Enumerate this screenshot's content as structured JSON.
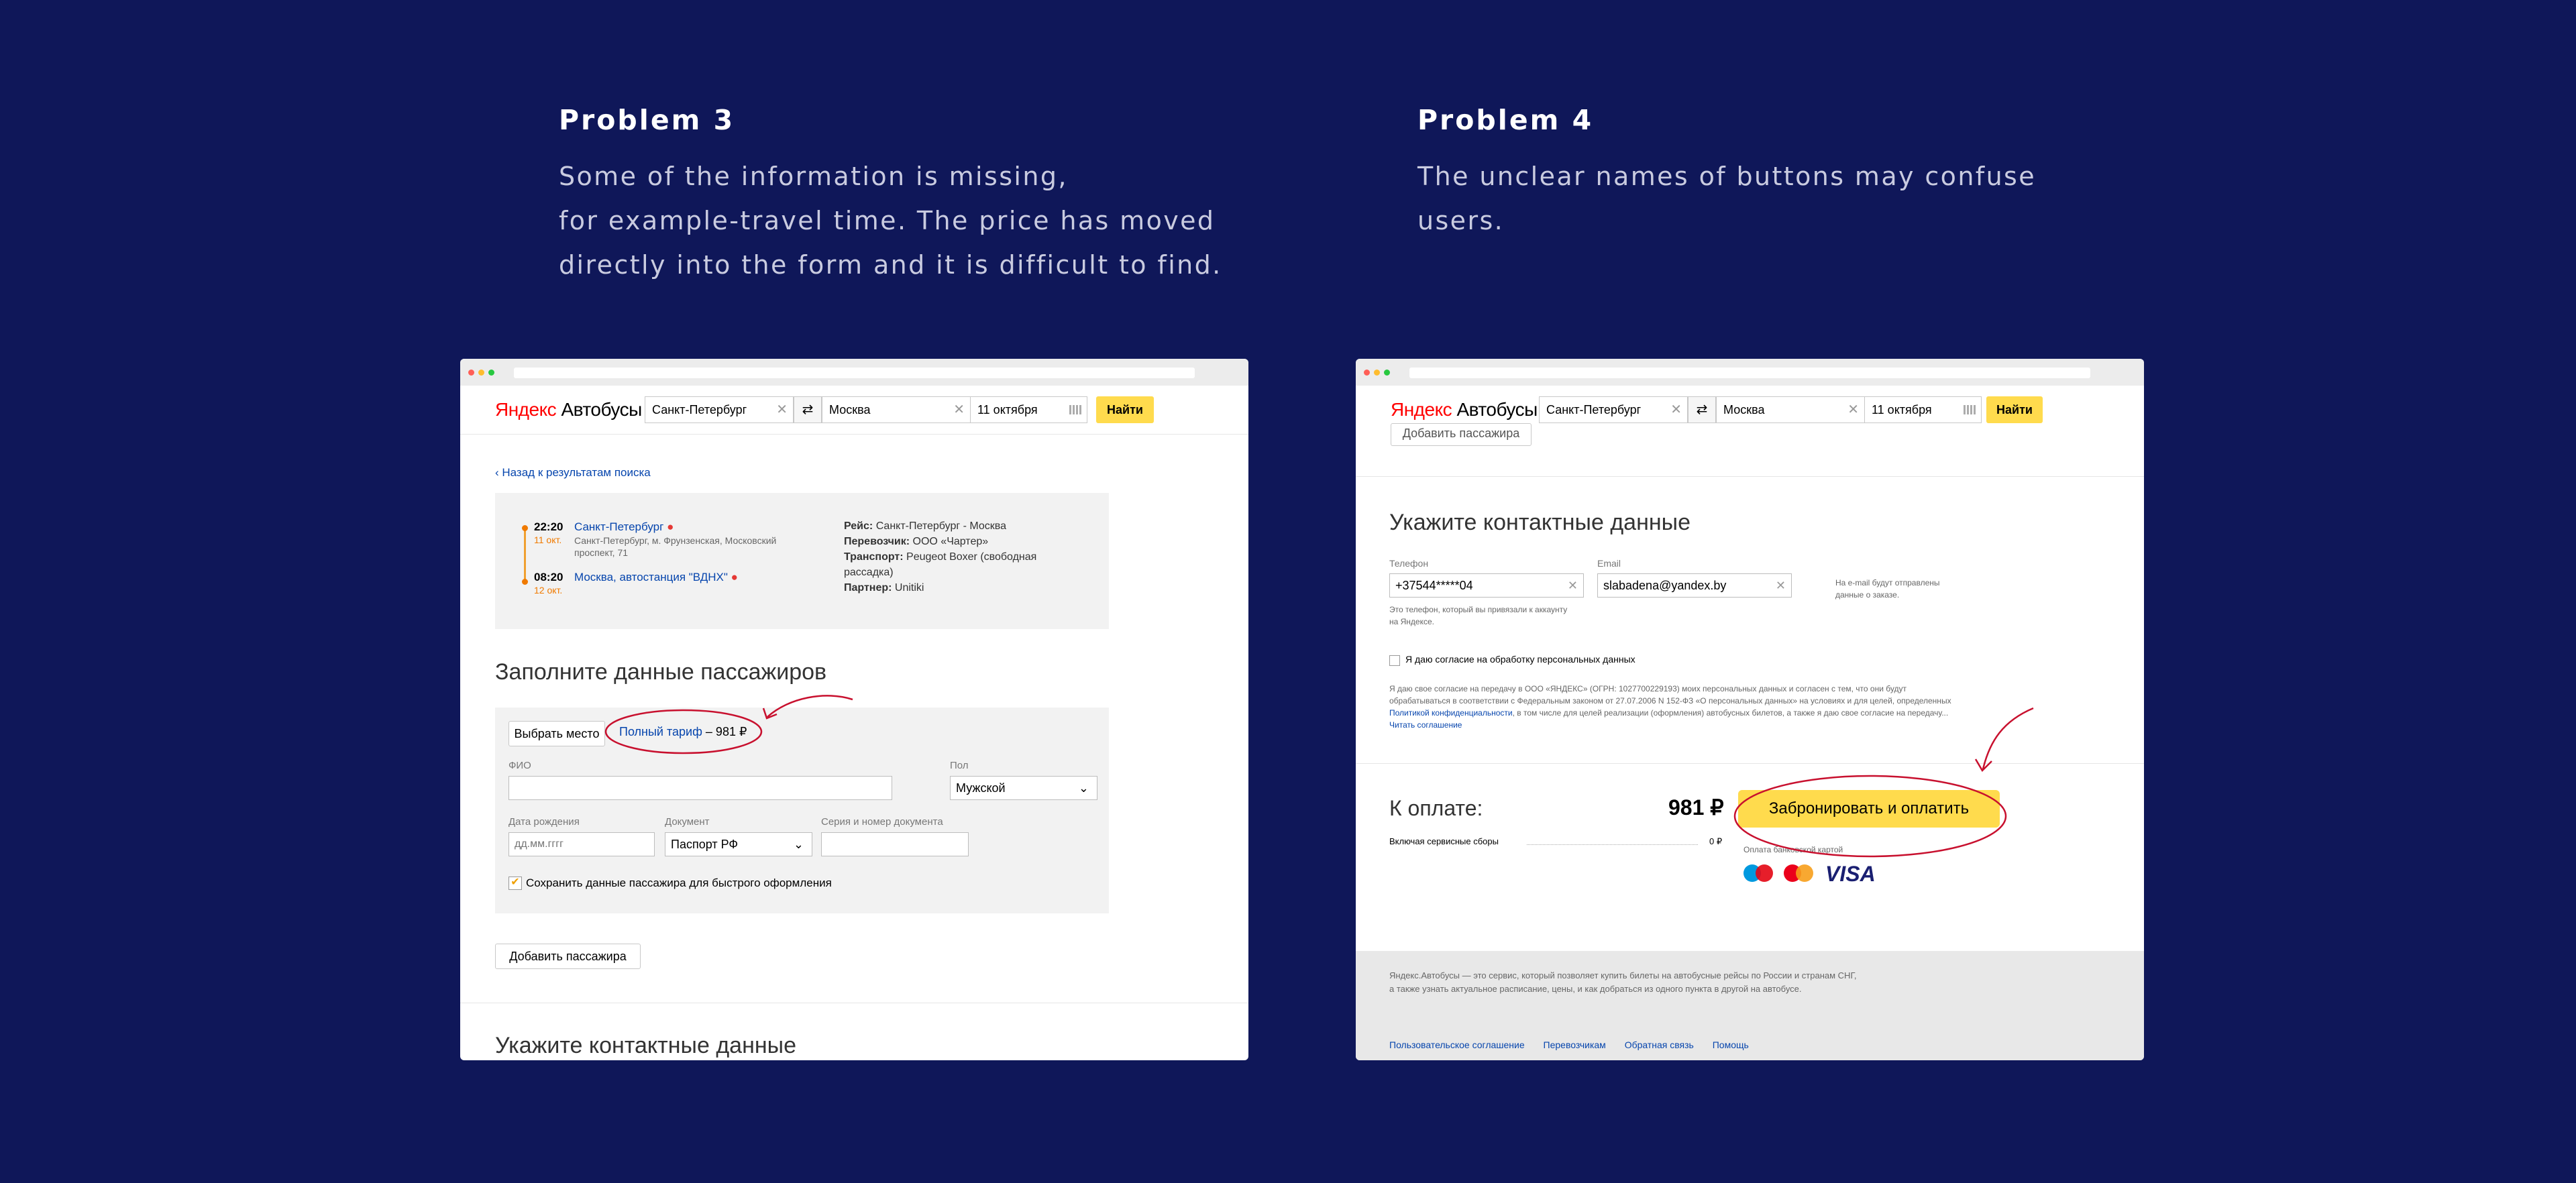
{
  "left": {
    "heading": "Problem 3",
    "description": [
      "Some of the information is missing,",
      "for example-travel time. The price has moved",
      "directly into the form and it is difficult to find."
    ],
    "screenshot": {
      "logo": "Яндекс",
      "logo_product": "Автобусы",
      "from": "Санкт-Петербург",
      "to": "Москва",
      "date": "11 октября",
      "find": "Найти",
      "back_link": "Назад к результатам поиска",
      "depart_time": "22:20",
      "depart_date": "11 окт.",
      "depart_city": "Санкт-Петербург",
      "depart_address": [
        "Санкт-Петербург, м. Фрунзенская, Московский",
        "проспект, 71"
      ],
      "arrive_time": "08:20",
      "arrive_date": "12 окт.",
      "arrive_place": "Москва, автостанция \"ВДНХ\"",
      "route_label": "Рейс:",
      "route_value": "Санкт-Петербург - Москва",
      "carrier_label": "Перевозчик:",
      "carrier_value": "ООО «Чартер»",
      "transport_label": "Транспорт:",
      "transport_value": [
        "Peugeot Boxer (свободная",
        "рассадка)"
      ],
      "partner_label": "Партнер:",
      "partner_value": "Unitiki",
      "passengers_title": "Заполните данные пассажиров",
      "choose_seat": "Выбрать место",
      "tariff_link": "Полный тариф",
      "tariff_price": " – 981 ₽",
      "name_label": "ФИО",
      "gender_label": "Пол",
      "gender_value": "Мужской",
      "birth_label": "Дата рождения",
      "birth_placeholder": "дд.мм.гггг",
      "doc_label": "Документ",
      "doc_value": "Паспорт РФ",
      "doc_number_label": "Серия и номер документа",
      "save_data": "Сохранить данные пассажира для быстрого оформления",
      "add_passenger": "Добавить пассажира",
      "contacts_title": "Укажите контактные данные"
    }
  },
  "right": {
    "heading": "Problem 4",
    "description": [
      "The unclear names of buttons may confuse",
      "users."
    ],
    "screenshot": {
      "logo": "Яндекс",
      "logo_product": "Автобусы",
      "from": "Санкт-Петербург",
      "to": "Москва",
      "date": "11 октября",
      "find": "Найти",
      "top_clipped": "Добавить пассажира",
      "contacts_title": "Укажите контактные данные",
      "phone_label": "Телефон",
      "phone_value": "+37544*****04",
      "phone_hint": [
        "Это телефон, который вы привязали к аккаунту",
        "на Яндексе."
      ],
      "email_label": "Email",
      "email_value": "slabadena@yandex.by",
      "email_hint": [
        "На e-mail будут отправлены",
        "данные о заказе."
      ],
      "consent_label": "Я даю согласие на обработку персональных данных",
      "consent_text": [
        "Я даю свое согласие на передачу в ООО «ЯНДЕКС» (ОГРН: 1027700229193) моих персональных данных и согласен с тем, что они будут",
        "обрабатываться в соответствии с Федеральным законом от 27.07.2006 N 152-ФЗ «О персональных данных» на условиях и для целей, определенных",
        ", в том числе для целей реализации (оформления) автобусных билетов, а также я даю свое согласие на передачу..."
      ],
      "privacy_link": "Политикой конфиденциальности",
      "read_agreement": "Читать соглашение",
      "pay_label": "К оплате:",
      "pay_amount": "981 ₽",
      "service_fee_label": "Включая сервисные сборы",
      "service_fee_value": "0 ₽",
      "pay_button": "Забронировать и оплатить",
      "card_payment": "Оплата банковской картой",
      "visa": "VISA",
      "footer_text": [
        "Яндекс.Автобусы — это сервис, который позволяет купить билеты на автобусные рейсы по России и странам СНГ,",
        "а также узнать актуальное расписание, цены, и как добраться из одного пункта в другой на автобусе."
      ],
      "footer_links": [
        "Пользовательское соглашение",
        "Перевозчикам",
        "Обратная связь",
        "Помощь"
      ]
    }
  },
  "colors": {
    "background": "#0f1759",
    "accent_yellow": "#ffdb4d",
    "annotation_red": "#c8102e",
    "link_blue": "#0645ad"
  }
}
